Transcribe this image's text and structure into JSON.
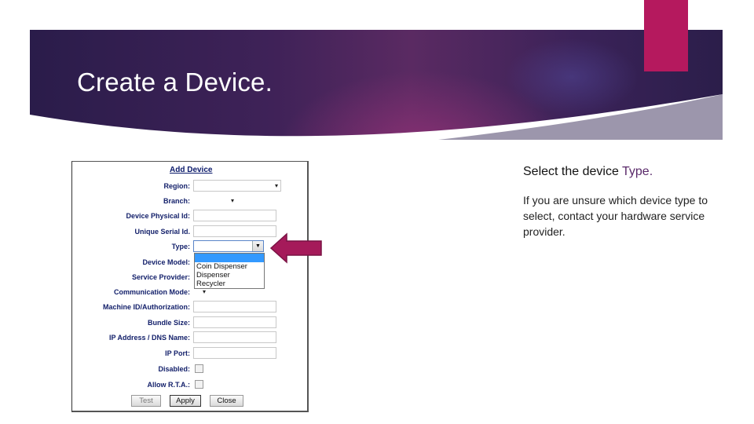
{
  "slide": {
    "title": "Create a Device."
  },
  "form": {
    "title": "Add Device",
    "fields": [
      {
        "label": "Region:",
        "kind": "select"
      },
      {
        "label": "Branch:",
        "kind": "select"
      },
      {
        "label": "Device Physical Id:",
        "kind": "input"
      },
      {
        "label": "Unique Serial Id.",
        "kind": "input"
      },
      {
        "label": "Type:",
        "kind": "select"
      },
      {
        "label": "Device Model:",
        "kind": "blank"
      },
      {
        "label": "Service Provider:",
        "kind": "blank"
      },
      {
        "label": "Communication Mode:",
        "kind": "select"
      },
      {
        "label": "Machine ID/Authorization:",
        "kind": "input"
      },
      {
        "label": "Bundle Size:",
        "kind": "input"
      },
      {
        "label": "IP Address / DNS Name:",
        "kind": "input"
      },
      {
        "label": "IP Port:",
        "kind": "input"
      },
      {
        "label": "Disabled:",
        "kind": "checkbox"
      },
      {
        "label": "Allow R.T.A.:",
        "kind": "checkbox"
      }
    ],
    "type_options": [
      "Coin Dispenser",
      "Dispenser",
      "Recycler"
    ],
    "buttons": {
      "test": "Test",
      "apply": "Apply",
      "close": "Close"
    }
  },
  "instructions": {
    "heading_prefix": "Select the device ",
    "heading_highlight": "Type.",
    "body": "If you are unsure which device type to select, contact your hardware service provider."
  },
  "colors": {
    "banner_dark": "#2a1c4a",
    "banner_magenta": "#5a2a62",
    "accent": "#b5195e",
    "arrow": "#a51a5a",
    "highlight_text": "#5a2a6a"
  },
  "icons": {
    "pointer": "arrow-right-icon",
    "dropdown": "chevron-down-icon"
  }
}
